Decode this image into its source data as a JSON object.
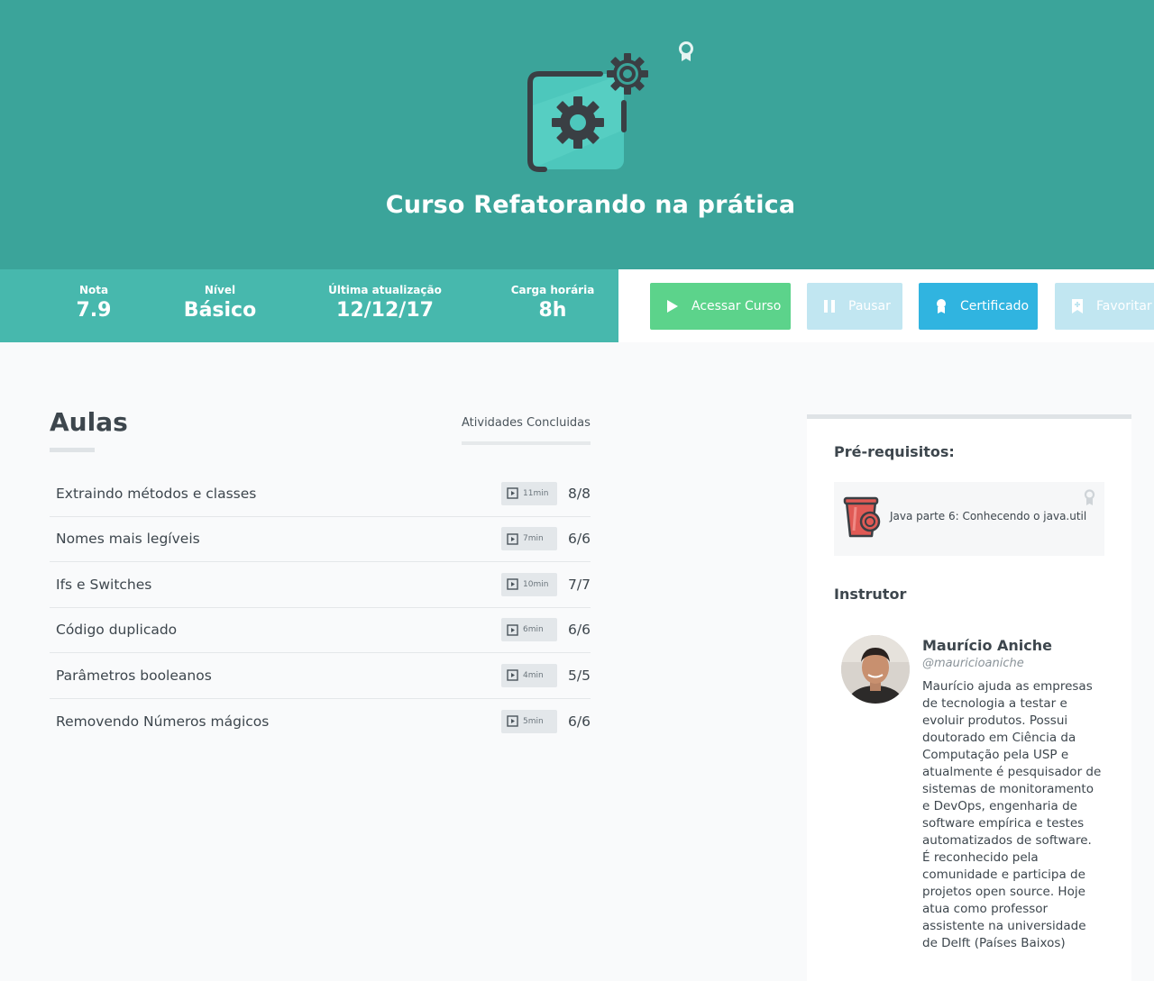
{
  "course": {
    "title": "Curso Refatorando na prática",
    "icon": "gear-screen-icon",
    "badge_icon": "certificate-badge-icon"
  },
  "stats": [
    {
      "label": "Nota",
      "value": "7.9"
    },
    {
      "label": "Nível",
      "value": "Básico"
    },
    {
      "label": "Última atualização",
      "value": "12/12/17"
    },
    {
      "label": "Carga horária",
      "value": "8h"
    }
  ],
  "actions": {
    "acessar": "Acessar Curso",
    "pausar": "Pausar",
    "certificado": "Certificado",
    "favoritar": "Favoritar"
  },
  "lessons_section": {
    "title": "Aulas",
    "activities_label": "Atividades Concluidas",
    "items": [
      {
        "name": "Extraindo métodos e classes",
        "duration": "11min",
        "progress": "8/8"
      },
      {
        "name": "Nomes mais legíveis",
        "duration": "7min",
        "progress": "6/6"
      },
      {
        "name": "Ifs e Switches",
        "duration": "10min",
        "progress": "7/7"
      },
      {
        "name": "Código duplicado",
        "duration": "6min",
        "progress": "6/6"
      },
      {
        "name": "Parâmetros booleanos",
        "duration": "4min",
        "progress": "5/5"
      },
      {
        "name": "Removendo Números mágicos",
        "duration": "5min",
        "progress": "6/6"
      }
    ]
  },
  "sidebar": {
    "prereq_title": "Pré-requisitos:",
    "prereq_course": "Java parte 6: Conhecendo o java.util",
    "instructor_title": "Instrutor",
    "instructor_name": "Maurício Aniche",
    "instructor_handle": "@mauricioaniche",
    "instructor_bio": "Maurício ajuda as empresas de tecnologia a testar e evoluir produtos. Possui doutorado em Ciência da Computação pela USP e atualmente é pesquisador de sistemas de monitoramento e DevOps, engenharia de software empírica e testes automatizados de software. É reconhecido pela comunidade e participa de projetos open source. Hoje atua como professor assistente na universidade de Delft (Países Baixos)"
  },
  "colors": {
    "hero": "#3ba49a",
    "stats_bar": "#47b8ad",
    "acessar": "#5cd38b",
    "certificado": "#30b4e0",
    "disabled": "#c1e6f1"
  }
}
